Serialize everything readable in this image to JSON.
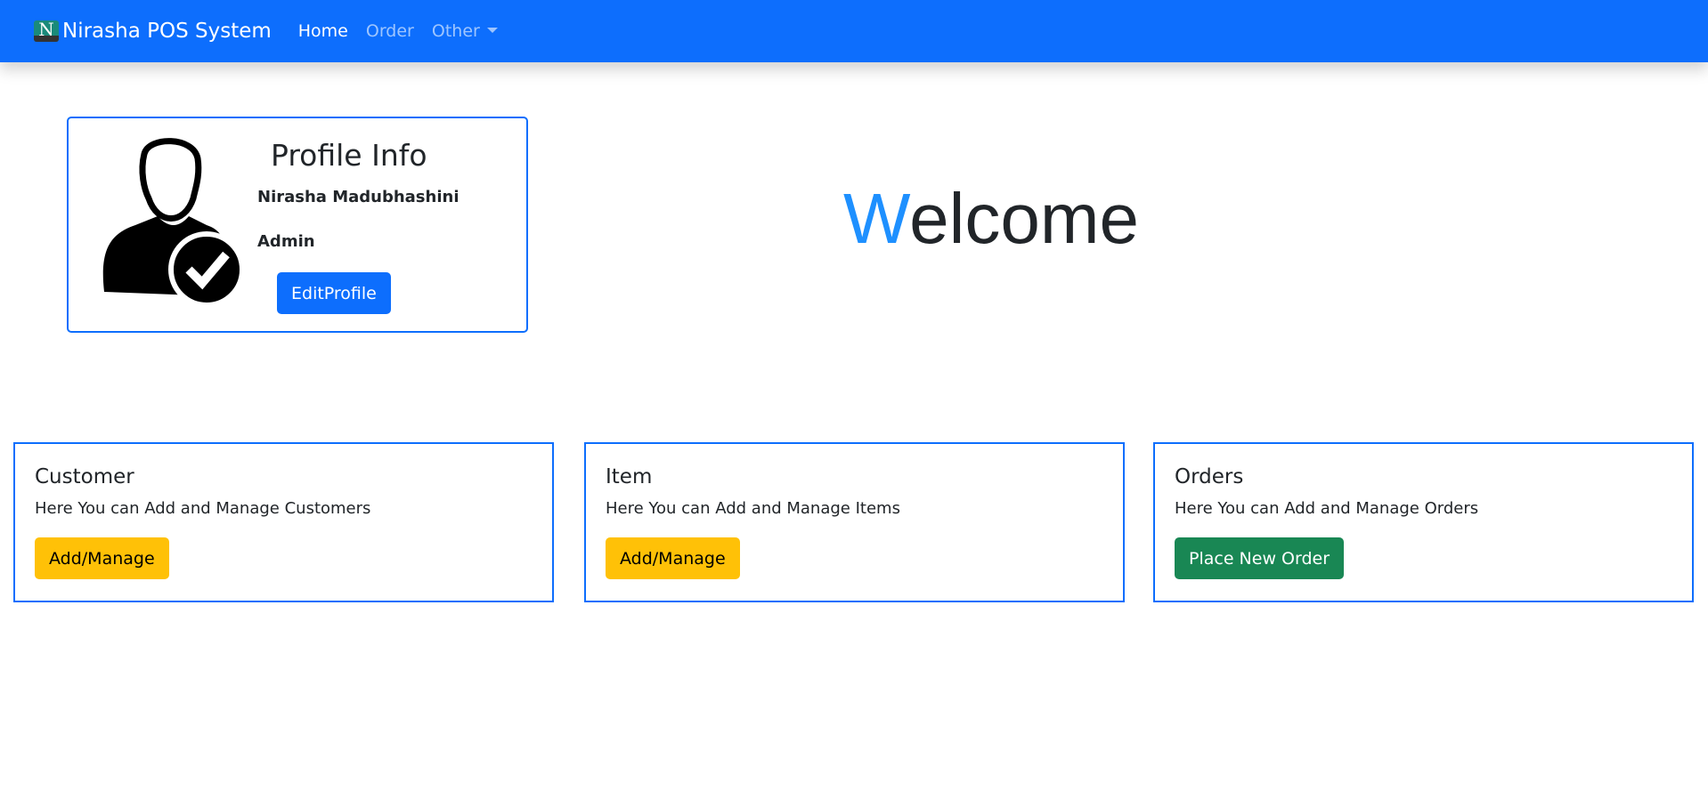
{
  "navbar": {
    "brand": "Nirasha POS System",
    "logo_letter": "N",
    "links": [
      {
        "label": "Home",
        "active": true
      },
      {
        "label": "Order"
      },
      {
        "label": "Other",
        "dropdown": true
      }
    ]
  },
  "profile": {
    "title": "Profile Info",
    "name": "Nirasha Madubhashini",
    "role": "Admin",
    "edit_label": "EditProfile"
  },
  "welcome": {
    "first_letter": "W",
    "rest": "elcome"
  },
  "cards": [
    {
      "title": "Customer",
      "text": "Here You can Add and Manage Customers",
      "button": "Add/Manage"
    },
    {
      "title": "Item",
      "text": "Here You can Add and Manage Items",
      "button": "Add/Manage"
    },
    {
      "title": "Orders",
      "text": "Here You can Add and Manage Orders",
      "button": "Place New Order"
    }
  ],
  "colors": {
    "primary": "#0d6efd",
    "warning": "#ffc107",
    "success": "#198754",
    "welcome_accent": "#1e90ff"
  }
}
